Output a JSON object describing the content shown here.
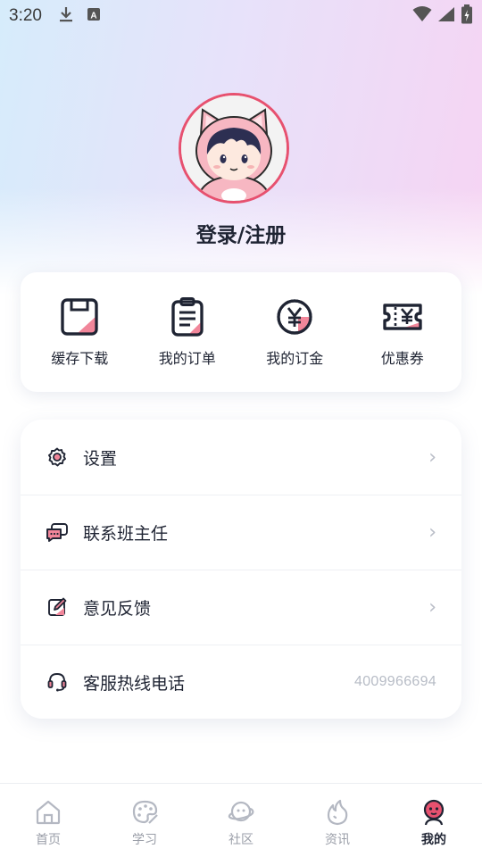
{
  "status_bar": {
    "time": "3:20",
    "icons": [
      "download-icon",
      "text-a-icon",
      "wifi-icon",
      "signal-icon",
      "battery-icon"
    ]
  },
  "profile": {
    "login_label": "登录/注册",
    "avatar_icon": "cat-hood-avatar-icon"
  },
  "quick_actions": [
    {
      "label": "缓存下载",
      "icon": "floppy-download-icon"
    },
    {
      "label": "我的订单",
      "icon": "clipboard-order-icon"
    },
    {
      "label": "我的订金",
      "icon": "yen-coin-icon"
    },
    {
      "label": "优惠券",
      "icon": "coupon-ticket-icon"
    }
  ],
  "menu": {
    "settings": {
      "label": "设置",
      "icon": "gear-icon",
      "chevron": "›"
    },
    "contact": {
      "label": "联系班主任",
      "icon": "chat-bubbles-icon",
      "chevron": "›"
    },
    "feedback": {
      "label": "意见反馈",
      "icon": "edit-note-icon",
      "chevron": "›"
    },
    "hotline": {
      "label": "客服热线电话",
      "icon": "headset-icon",
      "phone": "4009966694"
    }
  },
  "bottom_nav": [
    {
      "label": "首页",
      "icon": "home-icon",
      "active": false
    },
    {
      "label": "学习",
      "icon": "palette-icon",
      "active": false
    },
    {
      "label": "社区",
      "icon": "planet-face-icon",
      "active": false
    },
    {
      "label": "资讯",
      "icon": "flame-icon",
      "active": false
    },
    {
      "label": "我的",
      "icon": "profile-face-icon",
      "active": true
    }
  ],
  "colors": {
    "accent": "#e7516f",
    "pink": "#f1869a",
    "dark": "#1f2433",
    "muted": "#9a9ea8"
  }
}
